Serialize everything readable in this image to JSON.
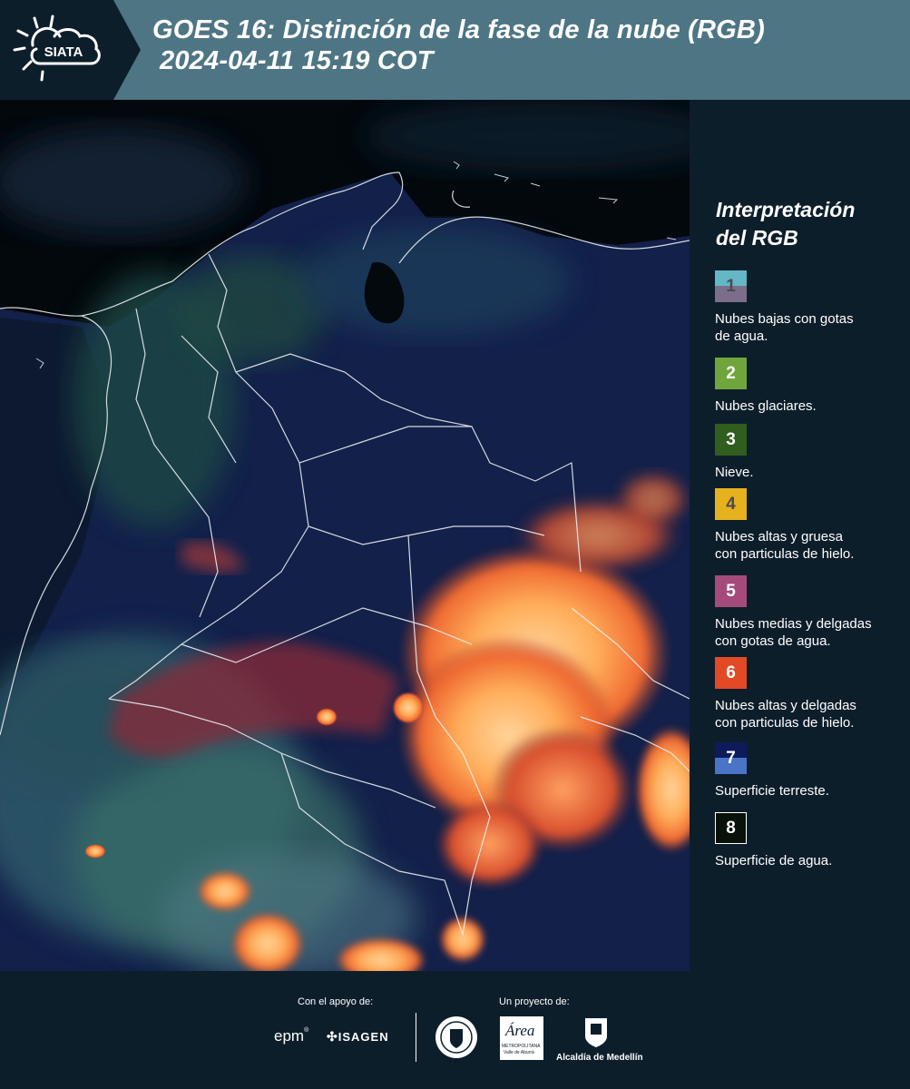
{
  "header": {
    "logo_text": "SIATA",
    "title_line1": "GOES 16: Distinción de la fase de la nube (RGB)",
    "title_line2": "2024-04-11 15:19 COT"
  },
  "legend": {
    "title_line1": "Interpretación",
    "title_line2": "del RGB",
    "items": [
      {
        "number": "1",
        "label_line1": "Nubes bajas con gotas",
        "label_line2": "de agua.",
        "color_top": "#64b7c4",
        "color_bottom": "#7b6e8a",
        "num_color": "#4a4a55"
      },
      {
        "number": "2",
        "label_line1": "Nubes glaciares.",
        "label_line2": "",
        "color_top": "#6fa53a",
        "color_bottom": "#6fa53a",
        "num_color": "#ffffff"
      },
      {
        "number": "3",
        "label_line1": "Nieve.",
        "label_line2": "",
        "color_top": "#2f5e1e",
        "color_bottom": "#2f5e1e",
        "num_color": "#ffffff"
      },
      {
        "number": "4",
        "label_line1": "Nubes altas y gruesa",
        "label_line2": "con particulas de hielo.",
        "color_top": "#e6b11e",
        "color_bottom": "#e6b11e",
        "num_color": "#4a4a55"
      },
      {
        "number": "5",
        "label_line1": "Nubes medias y delgadas",
        "label_line2": "con gotas de agua.",
        "color_top": "#a44b7c",
        "color_bottom": "#a44b7c",
        "num_color": "#ffffff"
      },
      {
        "number": "6",
        "label_line1": "Nubes altas y delgadas",
        "label_line2": "con particulas de hielo.",
        "color_top": "#e24a26",
        "color_bottom": "#e24a26",
        "num_color": "#ffffff"
      },
      {
        "number": "7",
        "label_line1": "Superficie terreste.",
        "label_line2": "",
        "color_top": "#0e1a5a",
        "color_bottom": "#4a74c8",
        "num_color": "#ffffff"
      },
      {
        "number": "8",
        "label_line1": "Superficie de agua.",
        "label_line2": "",
        "color_top": "#081208",
        "color_bottom": "#081208",
        "num_color": "#ffffff"
      }
    ]
  },
  "footer": {
    "support_label": "Con el apoyo de:",
    "project_label": "Un proyecto de:",
    "sponsor1": "epm",
    "sponsor2": "ISAGEN",
    "partner2_word": "Área",
    "partner2_sub1": "METROPOLITANA",
    "partner2_sub2": "Valle de Aburrá",
    "partner3": "Alcaldía de Medellín"
  }
}
